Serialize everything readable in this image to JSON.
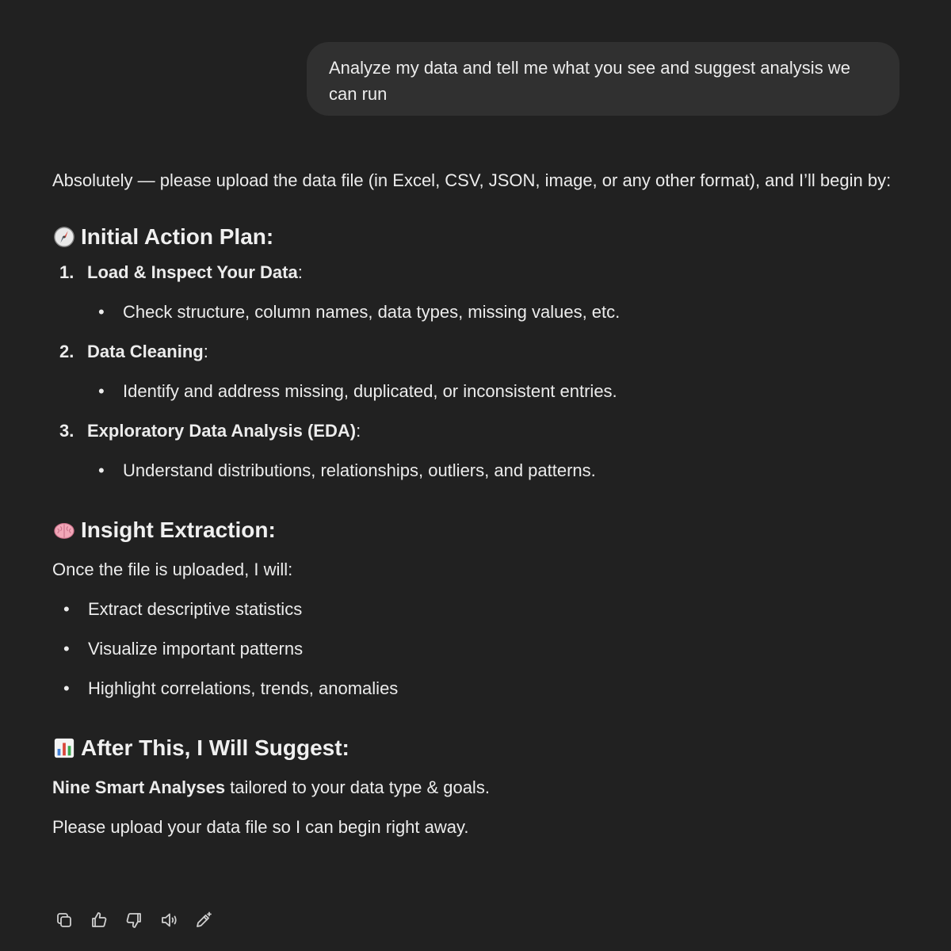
{
  "user_message": "Analyze my data and tell me what you see and suggest analysis we can run",
  "assistant": {
    "intro": "Absolutely — please upload the data file (in Excel, CSV, JSON, image, or any other format), and I’ll begin by:",
    "plan": {
      "emoji": "🧭",
      "heading": "Initial Action Plan:",
      "steps": [
        {
          "num": "1.",
          "title": "Load & Inspect Your Data",
          "colon": ":",
          "detail": "Check structure, column names, data types, missing values, etc."
        },
        {
          "num": "2.",
          "title": "Data Cleaning",
          "colon": ":",
          "detail": "Identify and address missing, duplicated, or inconsistent entries."
        },
        {
          "num": "3.",
          "title": "Exploratory Data Analysis (EDA)",
          "colon": ":",
          "detail": "Understand distributions, relationships, outliers, and patterns."
        }
      ]
    },
    "insight": {
      "emoji": "🧠",
      "heading": "Insight Extraction:",
      "lead": "Once the file is uploaded, I will:",
      "items": [
        "Extract descriptive statistics",
        "Visualize important patterns",
        "Highlight correlations, trends, anomalies"
      ]
    },
    "suggest": {
      "emoji": "📊",
      "heading": "After This, I Will Suggest:",
      "bold": "Nine Smart Analyses",
      "rest": " tailored to your data type & goals.",
      "closing": "Please upload your data file so I can begin right away."
    },
    "bullet": "•"
  },
  "actions": [
    "copy-icon",
    "thumbs-up-icon",
    "thumbs-down-icon",
    "read-aloud-icon",
    "edit-sparkle-icon"
  ]
}
